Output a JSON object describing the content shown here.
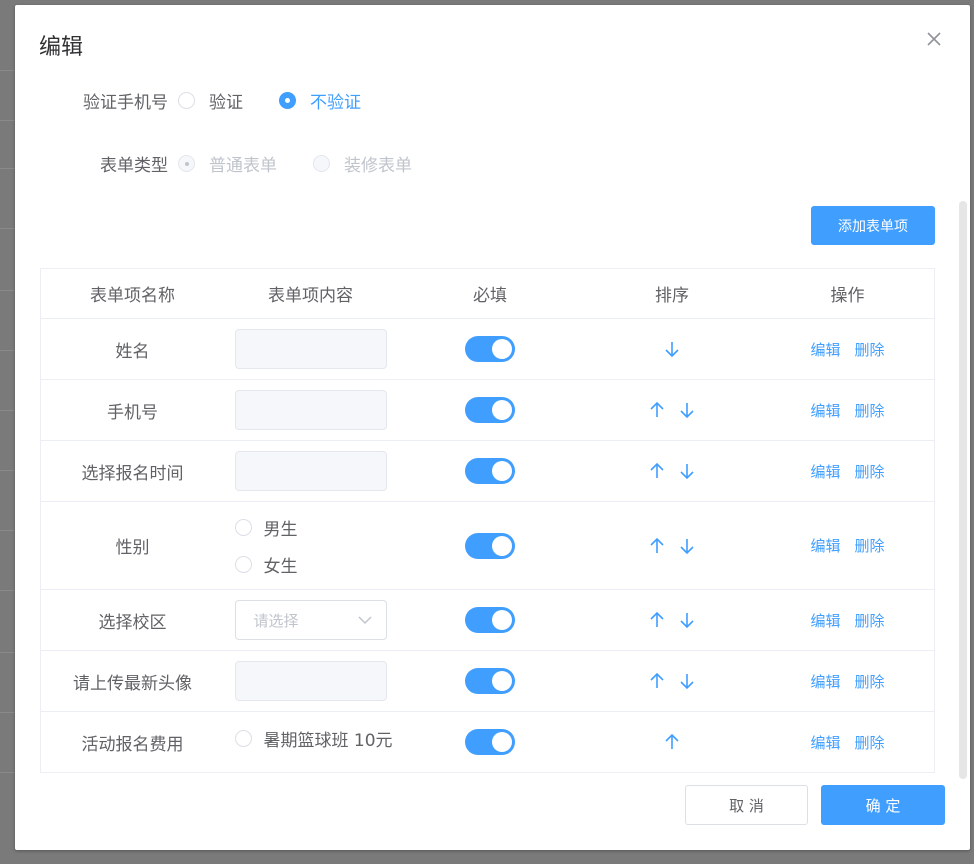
{
  "dialog": {
    "title": "编辑",
    "verify_phone": {
      "label": "验证手机号",
      "options": [
        "验证",
        "不验证"
      ],
      "selected": "不验证"
    },
    "form_type": {
      "label": "表单类型",
      "options": [
        "普通表单",
        "装修表单"
      ],
      "selected": "普通表单"
    },
    "add_button": "添加表单项",
    "table": {
      "headers": [
        "表单项名称",
        "表单项内容",
        "必填",
        "排序",
        "操作"
      ],
      "rows": [
        {
          "name": "姓名",
          "content_type": "input",
          "required": true,
          "up": false,
          "down": true
        },
        {
          "name": "手机号",
          "content_type": "input",
          "required": true,
          "up": true,
          "down": true
        },
        {
          "name": "选择报名时间",
          "content_type": "input",
          "required": true,
          "up": true,
          "down": true
        },
        {
          "name": "性别",
          "content_type": "radio",
          "options": [
            "男生",
            "女生"
          ],
          "required": true,
          "up": true,
          "down": true
        },
        {
          "name": "选择校区",
          "content_type": "select",
          "placeholder": "请选择",
          "required": true,
          "up": true,
          "down": true
        },
        {
          "name": "请上传最新头像",
          "content_type": "input",
          "required": true,
          "up": true,
          "down": true
        },
        {
          "name": "活动报名费用",
          "content_type": "radio",
          "options": [
            "暑期篮球班 10元"
          ],
          "required": true,
          "up": true,
          "down": false
        }
      ],
      "edit_label": "编辑",
      "delete_label": "删除"
    },
    "cancel_label": "取 消",
    "confirm_label": "确 定"
  },
  "colors": {
    "primary": "#409eff",
    "text": "#606266",
    "border": "#ebeef5"
  },
  "icons": {
    "close": "close-icon",
    "up": "arrow-up-icon",
    "down": "arrow-down-icon",
    "select": "chevron-down-icon"
  }
}
